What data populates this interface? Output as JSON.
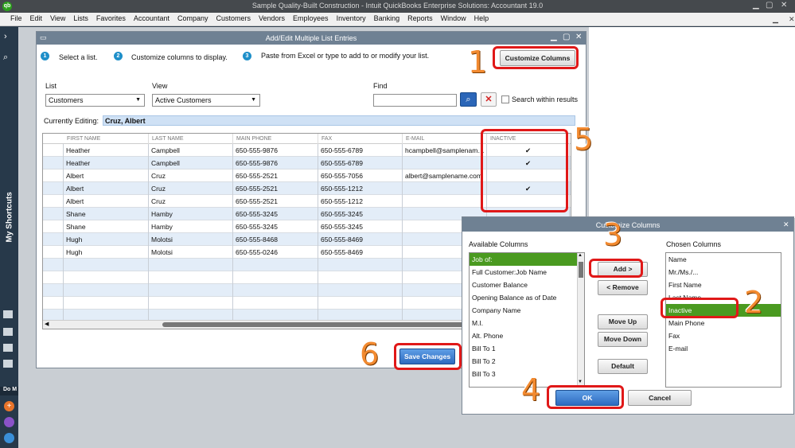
{
  "app": {
    "title": "Sample Quality-Built Construction  - Intuit QuickBooks Enterprise Solutions: Accountant 19.0",
    "logo": "qb"
  },
  "menu": [
    "File",
    "Edit",
    "View",
    "Lists",
    "Favorites",
    "Accountant",
    "Company",
    "Customers",
    "Vendors",
    "Employees",
    "Inventory",
    "Banking",
    "Reports",
    "Window",
    "Help"
  ],
  "rail": {
    "shortcuts_label": "My Shortcuts",
    "do_more_label": "Do M"
  },
  "window": {
    "title": "Add/Edit Multiple List Entries",
    "steps": [
      {
        "num": "1",
        "label": "Select a list."
      },
      {
        "num": "2",
        "label": "Customize columns to display."
      },
      {
        "num": "3",
        "label": "Paste from Excel or type to add to or modify your list."
      }
    ],
    "customize_button": "Customize Columns",
    "list_label": "List",
    "list_value": "Customers",
    "view_label": "View",
    "view_value": "Active Customers",
    "find_label": "Find",
    "find_value": "",
    "search_within_label": "Search within results",
    "currently_editing_label": "Currently Editing:",
    "currently_editing_value": "Cruz, Albert",
    "columns": [
      "FIRST NAME",
      "LAST NAME",
      "MAIN PHONE",
      "FAX",
      "E-MAIL",
      "INACTIVE"
    ],
    "rows": [
      [
        "Heather",
        "Campbell",
        "650-555-9876",
        "650-555-6789",
        "hcampbell@samplenam…",
        "✔"
      ],
      [
        "Heather",
        "Campbell",
        "650-555-9876",
        "650-555-6789",
        "",
        "✔"
      ],
      [
        "Albert",
        "Cruz",
        "650-555-2521",
        "650-555-7056",
        "albert@samplename.com",
        ""
      ],
      [
        "Albert",
        "Cruz",
        "650-555-2521",
        "650-555-1212",
        "",
        "✔"
      ],
      [
        "Albert",
        "Cruz",
        "650-555-2521",
        "650-555-1212",
        "",
        ""
      ],
      [
        "Shane",
        "Hamby",
        "650-555-3245",
        "650-555-3245",
        "",
        ""
      ],
      [
        "Shane",
        "Hamby",
        "650-555-3245",
        "650-555-3245",
        "",
        ""
      ],
      [
        "Hugh",
        "Molotsi",
        "650-555-8468",
        "650-555-8469",
        "",
        ""
      ],
      [
        "Hugh",
        "Molotsi",
        "650-555-0246",
        "650-555-8469",
        "",
        ""
      ]
    ],
    "save_button": "Save Changes"
  },
  "dialog": {
    "title": "Customize Columns",
    "available_label": "Available Columns",
    "available": [
      "Job of:",
      "Full Customer:Job Name",
      "Customer Balance",
      "Opening Balance as of Date",
      "Company Name",
      "M.I.",
      "Alt. Phone",
      "Bill To 1",
      "Bill To 2",
      "Bill To 3"
    ],
    "chosen_label": "Chosen Columns",
    "chosen": [
      "Name",
      "Mr./Ms./...",
      "First Name",
      "Last Name",
      "Inactive",
      "Main Phone",
      "Fax",
      "E-mail"
    ],
    "add_button": "Add >",
    "remove_button": "< Remove",
    "move_up_button": "Move Up",
    "move_down_button": "Move Down",
    "default_button": "Default",
    "ok_button": "OK",
    "cancel_button": "Cancel"
  },
  "callouts": [
    "1",
    "2",
    "3",
    "4",
    "5",
    "6"
  ],
  "colors": {
    "accent": "#2e6bc0",
    "selection": "#4a9a20",
    "callout": "#e01818",
    "number": "#f28a30"
  }
}
